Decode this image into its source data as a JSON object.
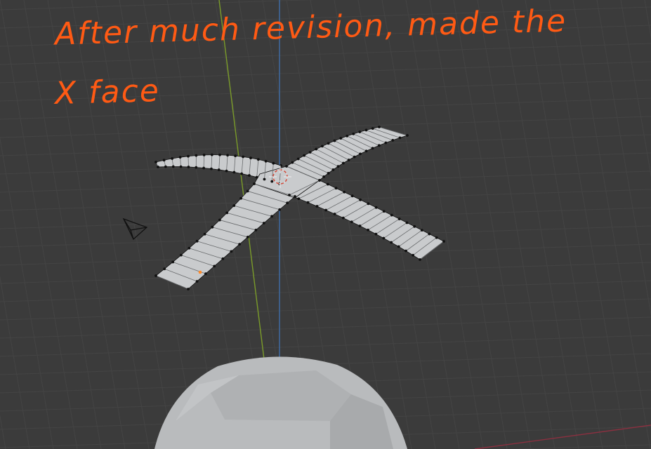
{
  "annotation": {
    "line1": "After much revision, made the",
    "line2": "X face",
    "color": "#ff5a14"
  },
  "scene": {
    "background": "#3b3b3b",
    "grid_color": "#444444",
    "y_axis_color": "#7a9a2a",
    "z_axis_color": "#3f6ea8",
    "x_axis_color": "#8a3040",
    "mesh_fill": "#c9cbcd",
    "vertex_color": "#111111",
    "selected_vertex_color": "#ff8a2a",
    "sphere_color": "#b9bbbd",
    "camera_icon": "camera-icon",
    "cursor_icon": "3d-cursor-icon"
  }
}
